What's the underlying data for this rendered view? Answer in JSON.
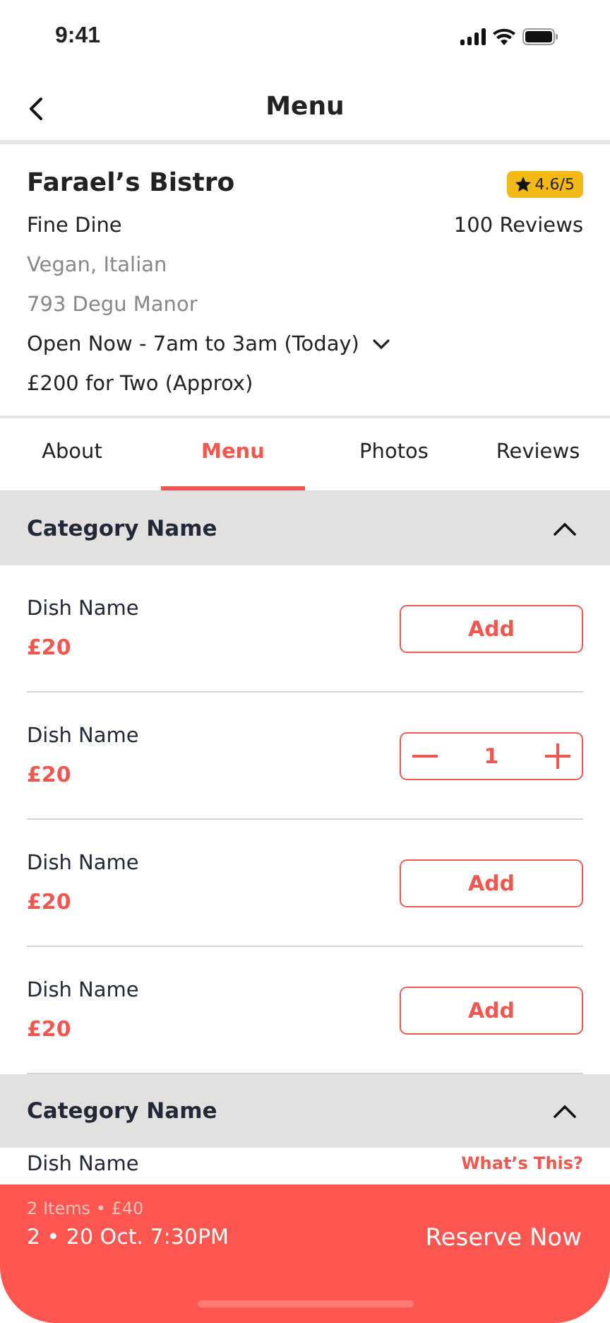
{
  "status_bar": {
    "time": "9:41"
  },
  "nav": {
    "title": "Menu"
  },
  "restaurant": {
    "name": "Farael’s Bistro",
    "rating": "4.6/5",
    "type": "Fine Dine",
    "reviews": "100 Reviews",
    "cuisine": "Vegan, Italian",
    "address": "793 Degu Manor",
    "hours": "Open Now - 7am to 3am (Today)",
    "price": "£200 for Two (Approx)"
  },
  "tabs": [
    {
      "label": "About",
      "selected": false
    },
    {
      "label": "Menu",
      "selected": true
    },
    {
      "label": "Photos",
      "selected": false
    },
    {
      "label": "Reviews",
      "selected": false
    }
  ],
  "categories": [
    {
      "name": "Category Name",
      "expanded": true,
      "dishes": [
        {
          "name": "Dish Name",
          "price": "£20",
          "kind": "add",
          "action": "Add"
        },
        {
          "name": "Dish Name",
          "price": "£20",
          "kind": "stepper",
          "quantity": "1"
        },
        {
          "name": "Dish Name",
          "price": "£20",
          "kind": "add",
          "action": "Add"
        },
        {
          "name": "Dish Name",
          "price": "£20",
          "kind": "add",
          "action": "Add"
        }
      ]
    },
    {
      "name": "Category Name",
      "expanded": true,
      "dishes": [
        {
          "name": "Dish Name",
          "kind": "info",
          "link": "What’s This?"
        }
      ]
    }
  ],
  "cart_bar": {
    "summary": "2 Items • £40",
    "booking": "2 • 20 Oct. 7:30PM",
    "action": "Reserve Now"
  }
}
